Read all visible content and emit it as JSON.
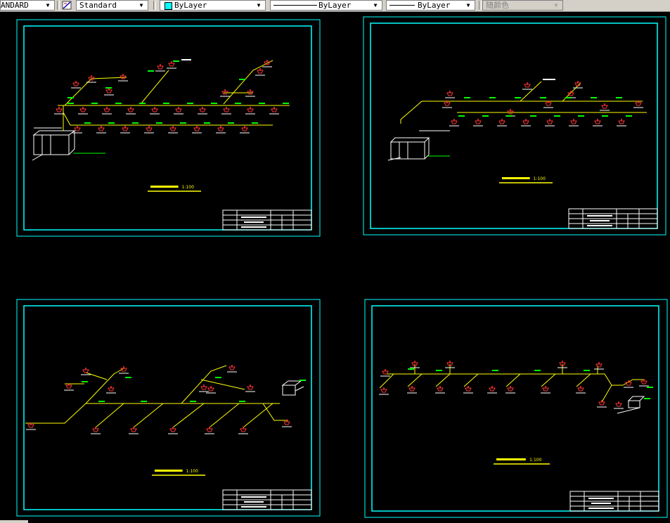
{
  "toolbar": {
    "textstyle_value": "ANDARD",
    "style_value": "Standard",
    "layer_value": "ByLayer",
    "linetype_value": "ByLayer",
    "lineweight_value": "ByLayer",
    "color_value": "随颜色",
    "layer_swatch_color": "#00ffff",
    "icons": [
      "dimstyle-icon",
      "dropdown-arrow-icon"
    ]
  },
  "drawing": {
    "background": "#000000",
    "frame_color": "#00ffff",
    "pipe_color": "#ffff00",
    "duct_label_color": "#00ff00",
    "diffuser_color": "#ff3333",
    "sheets": [
      {
        "title_scale": "1:100"
      },
      {
        "title_scale": "1:100"
      },
      {
        "title_scale": "1:100"
      },
      {
        "title_scale": "1:100"
      }
    ]
  }
}
